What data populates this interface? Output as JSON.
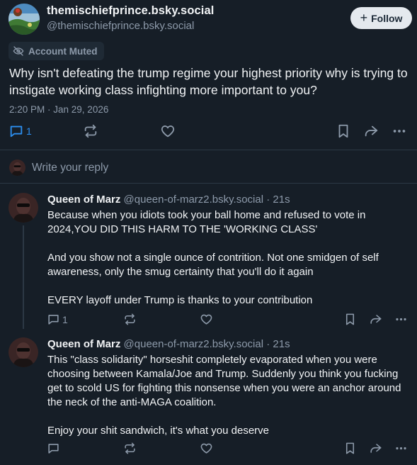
{
  "post": {
    "author_name": "themischiefprince.bsky.social",
    "author_handle": "@themischiefprince.bsky.social",
    "follow_label": "Follow",
    "muted_label": "Account Muted",
    "text": "Why isn't defeating the trump regime your highest priority why is trying to instigate working class infighting more important to you?",
    "timestamp": "2:20 PM · Jan 29, 2026",
    "reply_count": "1"
  },
  "reply_box": {
    "placeholder": "Write your reply"
  },
  "replies": [
    {
      "author_name": "Queen of Marz",
      "author_handle": "@queen-of-marz2.bsky.social",
      "age": "21s",
      "paragraphs": [
        "Because when you idiots took your ball home and refused to vote in 2024,YOU DID THIS HARM TO THE 'WORKING CLASS'",
        "And you show not a single ounce of contrition. Not one smidgen of self awareness, only the smug certainty that you'll do it again",
        "EVERY layoff under Trump is thanks to your contribution"
      ],
      "reply_count": "1"
    },
    {
      "author_name": "Queen of Marz",
      "author_handle": "@queen-of-marz2.bsky.social",
      "age": "21s",
      "paragraphs": [
        "This \"class solidarity\" horseshit completely evaporated when you were choosing between Kamala/Joe and Trump. Suddenly you think you fucking get to scold US for fighting this nonsense when you were an anchor around the neck of the anti-MAGA coalition.",
        "Enjoy your shit sandwich, it's what you deserve"
      ],
      "reply_count": ""
    }
  ],
  "icons": {
    "reply": "reply-bubble-icon",
    "repost": "repost-icon",
    "like": "heart-icon",
    "bookmark": "bookmark-icon",
    "share": "share-icon",
    "more": "more-icon",
    "muted": "eye-slash-icon"
  },
  "colors": {
    "background": "#161e27",
    "text": "#f1f3f5",
    "muted_text": "#8d9aaa",
    "border": "#2c3845",
    "follow_button_bg": "#e4e9ee"
  }
}
